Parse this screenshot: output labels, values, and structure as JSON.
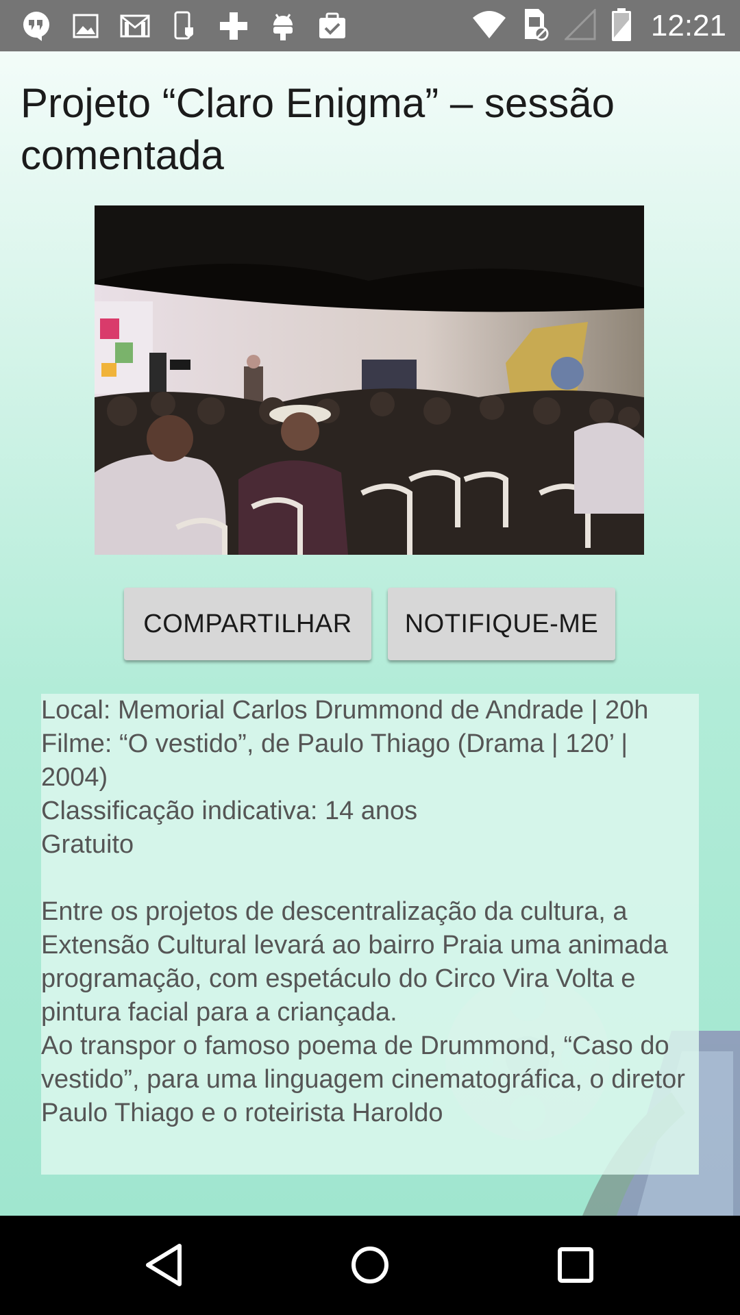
{
  "status_bar": {
    "time": "12:21",
    "left_icons": [
      "hangouts-icon",
      "gallery-icon",
      "gmail-icon",
      "phone-shield-icon",
      "plus-cross-icon",
      "android-icon",
      "clipboard-check-icon"
    ],
    "right_icons": [
      "wifi-icon",
      "sim-icon",
      "signal-icon",
      "battery-icon"
    ]
  },
  "event": {
    "title": "Projeto “Claro Enigma” – sessão comentada",
    "share_label": "COMPARTILHAR",
    "notify_label": "NOTIFIQUE-ME",
    "details": {
      "local": "Local: Memorial Carlos Drummond de Andrade | 20h",
      "film": "Filme: “O vestido”, de Paulo Thiago (Drama | 120’ | 2004)",
      "rating": "Classificação indicativa: 14 anos",
      "price": "Gratuito",
      "paragraph1": "Entre os projetos de descentralização da cultura, a Extensão Cultural levará ao bairro Praia uma animada programação, com espetáculo do Circo Vira Volta e pintura facial para a criançada.",
      "paragraph2": "Ao transpor o famoso poema de Drummond, “Caso do vestido”, para uma linguagem cinematográfica, o diretor Paulo Thiago e o roteirista Haroldo"
    }
  },
  "nav_bar": {
    "icons": [
      "back-icon",
      "home-icon",
      "recents-icon"
    ]
  },
  "colors": {
    "status_bar": "#757575",
    "button_bg": "#d7d7d7",
    "background_bottom": "#a0e6cf",
    "nav_bar": "#000000"
  }
}
